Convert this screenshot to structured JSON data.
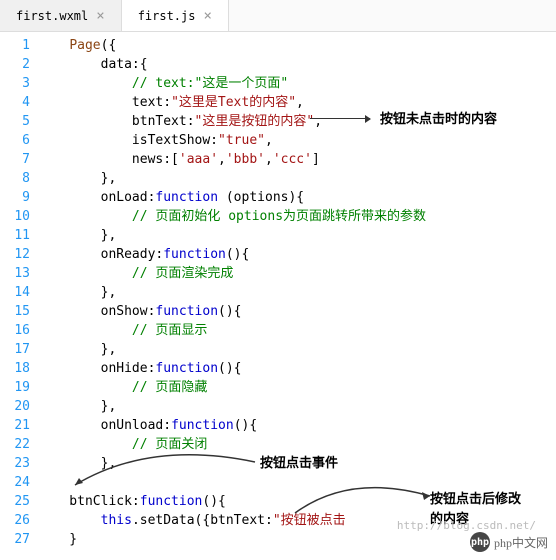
{
  "tabs": [
    {
      "label": "first.wxml",
      "active": false
    },
    {
      "label": "first.js",
      "active": true
    }
  ],
  "lines": [
    {
      "n": 1,
      "segs": [
        [
          "    ",
          "k-black"
        ],
        [
          "Page",
          "k-brown"
        ],
        [
          "({",
          "k-black"
        ]
      ]
    },
    {
      "n": 2,
      "segs": [
        [
          "        data:{",
          "k-black"
        ]
      ]
    },
    {
      "n": 3,
      "segs": [
        [
          "            ",
          "k-black"
        ],
        [
          "// text:\"这是一个页面\"",
          "k-green"
        ]
      ]
    },
    {
      "n": 4,
      "segs": [
        [
          "            text:",
          "k-black"
        ],
        [
          "\"这里是Text的内容\"",
          "k-string"
        ],
        [
          ",",
          "k-black"
        ]
      ]
    },
    {
      "n": 5,
      "segs": [
        [
          "            btnText:",
          "k-black"
        ],
        [
          "\"这里是按钮的内容\"",
          "k-string"
        ],
        [
          ",",
          "k-black"
        ]
      ]
    },
    {
      "n": 6,
      "segs": [
        [
          "            isTextShow:",
          "k-black"
        ],
        [
          "\"true\"",
          "k-string"
        ],
        [
          ",",
          "k-black"
        ]
      ]
    },
    {
      "n": 7,
      "segs": [
        [
          "            news:[",
          "k-black"
        ],
        [
          "'aaa'",
          "k-string"
        ],
        [
          ",",
          "k-black"
        ],
        [
          "'bbb'",
          "k-string"
        ],
        [
          ",",
          "k-black"
        ],
        [
          "'ccc'",
          "k-string"
        ],
        [
          "]",
          "k-black"
        ]
      ]
    },
    {
      "n": 8,
      "segs": [
        [
          "        },",
          "k-black"
        ]
      ]
    },
    {
      "n": 9,
      "segs": [
        [
          "        onLoad:",
          "k-black"
        ],
        [
          "function",
          "k-blue"
        ],
        [
          " (options){",
          "k-black"
        ]
      ]
    },
    {
      "n": 10,
      "segs": [
        [
          "            ",
          "k-black"
        ],
        [
          "// 页面初始化 options为页面跳转所带来的参数",
          "k-green"
        ]
      ]
    },
    {
      "n": 11,
      "segs": [
        [
          "        },",
          "k-black"
        ]
      ]
    },
    {
      "n": 12,
      "segs": [
        [
          "        onReady:",
          "k-black"
        ],
        [
          "function",
          "k-blue"
        ],
        [
          "(){",
          "k-black"
        ]
      ]
    },
    {
      "n": 13,
      "segs": [
        [
          "            ",
          "k-black"
        ],
        [
          "// 页面渲染完成",
          "k-green"
        ]
      ]
    },
    {
      "n": 14,
      "segs": [
        [
          "        },",
          "k-black"
        ]
      ]
    },
    {
      "n": 15,
      "segs": [
        [
          "        onShow:",
          "k-black"
        ],
        [
          "function",
          "k-blue"
        ],
        [
          "(){",
          "k-black"
        ]
      ]
    },
    {
      "n": 16,
      "segs": [
        [
          "            ",
          "k-black"
        ],
        [
          "// 页面显示",
          "k-green"
        ]
      ]
    },
    {
      "n": 17,
      "segs": [
        [
          "        },",
          "k-black"
        ]
      ]
    },
    {
      "n": 18,
      "segs": [
        [
          "        onHide:",
          "k-black"
        ],
        [
          "function",
          "k-blue"
        ],
        [
          "(){",
          "k-black"
        ]
      ]
    },
    {
      "n": 19,
      "segs": [
        [
          "            ",
          "k-black"
        ],
        [
          "// 页面隐藏",
          "k-green"
        ]
      ]
    },
    {
      "n": 20,
      "segs": [
        [
          "        },",
          "k-black"
        ]
      ]
    },
    {
      "n": 21,
      "segs": [
        [
          "        onUnload:",
          "k-black"
        ],
        [
          "function",
          "k-blue"
        ],
        [
          "(){",
          "k-black"
        ]
      ]
    },
    {
      "n": 22,
      "segs": [
        [
          "            ",
          "k-black"
        ],
        [
          "// 页面关闭",
          "k-green"
        ]
      ]
    },
    {
      "n": 23,
      "segs": [
        [
          "        },",
          "k-black"
        ]
      ]
    },
    {
      "n": 24,
      "segs": [
        [
          "",
          "k-black"
        ]
      ]
    },
    {
      "n": 25,
      "segs": [
        [
          "    btnClick:",
          "k-black"
        ],
        [
          "function",
          "k-blue"
        ],
        [
          "(){",
          "k-black"
        ]
      ]
    },
    {
      "n": 26,
      "segs": [
        [
          "        ",
          "k-black"
        ],
        [
          "this",
          "k-blue"
        ],
        [
          ".setData({btnText:",
          "k-black"
        ],
        [
          "\"按钮被点击",
          "k-string"
        ]
      ]
    },
    {
      "n": 27,
      "segs": [
        [
          "    }",
          "k-black"
        ]
      ]
    }
  ],
  "annotations": {
    "a1": "按钮未点击时的内容",
    "a2": "按钮点击事件",
    "a3a": "按钮点击后修改",
    "a3b": "的内容"
  },
  "watermark": {
    "text": "php中文网",
    "logo": "php",
    "url": "http://blog.csdn.net/"
  }
}
